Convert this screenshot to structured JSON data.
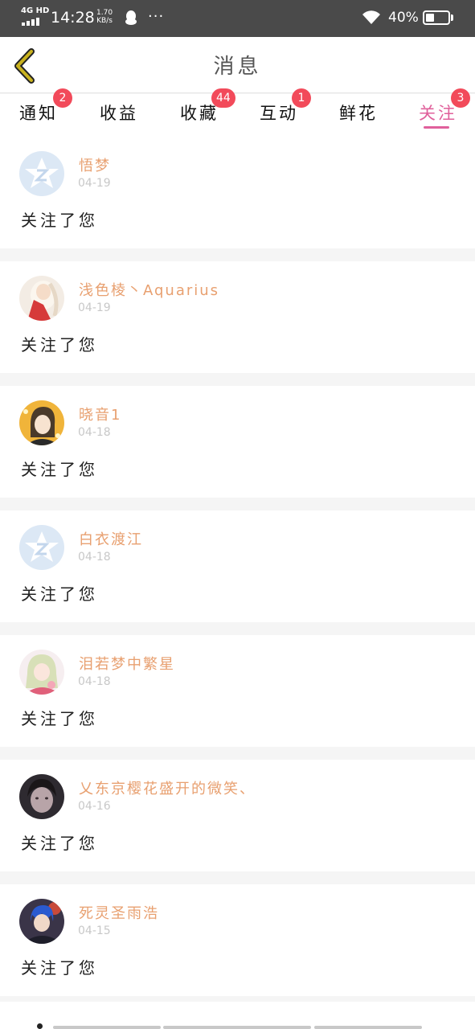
{
  "status_bar": {
    "network": "4G HD",
    "time": "14:28",
    "speed_value": "1.70",
    "speed_unit": "KB/s",
    "more": "···",
    "battery_percent": "40%",
    "battery_level": 0.4,
    "icons": [
      "signal-icon",
      "qq-icon",
      "wifi-icon",
      "battery-icon"
    ]
  },
  "header": {
    "title": "消息",
    "back_icon": "chevron-left-icon",
    "back_color": "#c9b21e"
  },
  "tabs": [
    {
      "label": "通知",
      "badge": "2"
    },
    {
      "label": "收益",
      "badge": ""
    },
    {
      "label": "收藏",
      "badge": "44"
    },
    {
      "label": "互动",
      "badge": "1"
    },
    {
      "label": "鲜花",
      "badge": ""
    },
    {
      "label": "关注",
      "badge": "3",
      "active": true
    }
  ],
  "colors": {
    "accent": "#e0609b",
    "badge": "#f24a5a",
    "username": "#e8a070",
    "date": "#c8c8c8"
  },
  "notifications": [
    {
      "username": "悟梦",
      "date": "04-19",
      "action": "关注了您",
      "avatar": "default-avatar-icon"
    },
    {
      "username": "浅色棱丶Aquarius",
      "date": "04-19",
      "action": "关注了您",
      "avatar": "user-avatar"
    },
    {
      "username": "晓音1",
      "date": "04-18",
      "action": "关注了您",
      "avatar": "user-avatar"
    },
    {
      "username": "白衣渡江",
      "date": "04-18",
      "action": "关注了您",
      "avatar": "default-avatar-icon"
    },
    {
      "username": "泪若梦中繁星",
      "date": "04-18",
      "action": "关注了您",
      "avatar": "user-avatar"
    },
    {
      "username": "乂东京樱花盛开的微笑、",
      "date": "04-16",
      "action": "关注了您",
      "avatar": "user-avatar"
    },
    {
      "username": "死灵圣雨浩",
      "date": "04-15",
      "action": "关注了您",
      "avatar": "user-avatar"
    }
  ]
}
